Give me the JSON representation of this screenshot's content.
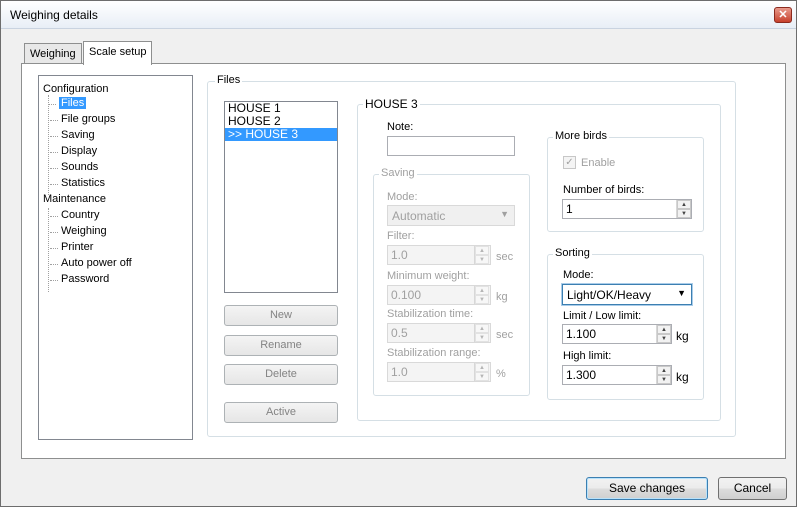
{
  "window": {
    "title": "Weighing details",
    "close_icon": "close-icon"
  },
  "tabs": [
    {
      "label": "Weighing",
      "active": false
    },
    {
      "label": "Scale setup",
      "active": true
    }
  ],
  "tree": {
    "sections": [
      {
        "label": "Configuration",
        "items": [
          "Files",
          "File groups",
          "Saving",
          "Display",
          "Sounds",
          "Statistics"
        ]
      },
      {
        "label": "Maintenance",
        "items": [
          "Country",
          "Weighing",
          "Printer",
          "Auto power off",
          "Password"
        ]
      }
    ],
    "selected": "Files"
  },
  "files_group": {
    "title": "Files",
    "list": [
      "HOUSE 1",
      "HOUSE 2",
      ">> HOUSE 3"
    ],
    "selected_index": 2,
    "buttons": {
      "new": "New",
      "rename": "Rename",
      "delete": "Delete",
      "active": "Active"
    }
  },
  "detail": {
    "title": "HOUSE 3",
    "note_label": "Note:",
    "note_value": "",
    "saving": {
      "title": "Saving",
      "mode_label": "Mode:",
      "mode_value": "Automatic",
      "filter_label": "Filter:",
      "filter_value": "1.0",
      "filter_unit": "sec",
      "min_weight_label": "Minimum weight:",
      "min_weight_value": "0.100",
      "min_weight_unit": "kg",
      "stab_time_label": "Stabilization time:",
      "stab_time_value": "0.5",
      "stab_time_unit": "sec",
      "stab_range_label": "Stabilization range:",
      "stab_range_value": "1.0",
      "stab_range_unit": "%"
    },
    "more_birds": {
      "title": "More birds",
      "enable_label": "Enable",
      "enable_checked": true,
      "count_label": "Number of birds:",
      "count_value": "1"
    },
    "sorting": {
      "title": "Sorting",
      "mode_label": "Mode:",
      "mode_value": "Light/OK/Heavy",
      "low_label": "Limit / Low limit:",
      "low_value": "1.100",
      "low_unit": "kg",
      "high_label": "High limit:",
      "high_value": "1.300",
      "high_unit": "kg"
    }
  },
  "footer": {
    "save": "Save changes",
    "cancel": "Cancel"
  }
}
